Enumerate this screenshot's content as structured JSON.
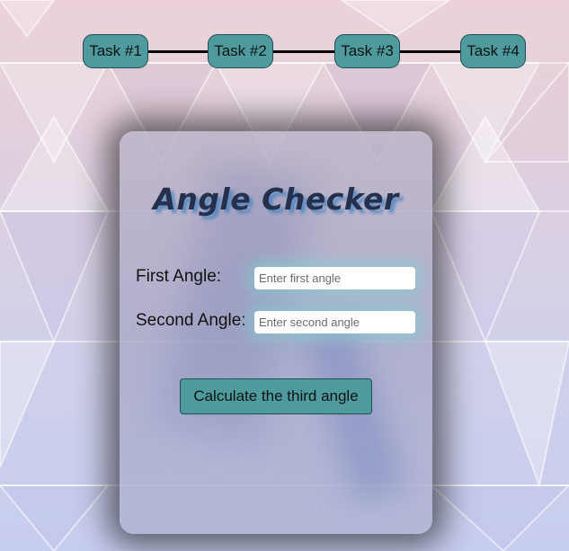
{
  "nav": {
    "tasks": [
      {
        "label": "Task #1"
      },
      {
        "label": "Task #2"
      },
      {
        "label": "Task #3"
      },
      {
        "label": "Task #4"
      }
    ]
  },
  "card": {
    "title": "Angle Checker",
    "first_angle": {
      "label": "First Angle:",
      "placeholder": "Enter first angle",
      "value": ""
    },
    "second_angle": {
      "label": "Second Angle:",
      "placeholder": "Enter second angle",
      "value": ""
    },
    "calculate_label": "Calculate the third angle"
  },
  "colors": {
    "button": "#4f9a9c",
    "title": "#25304d",
    "title_shadow": "#4682be",
    "input_glow": "#78d7d2"
  }
}
